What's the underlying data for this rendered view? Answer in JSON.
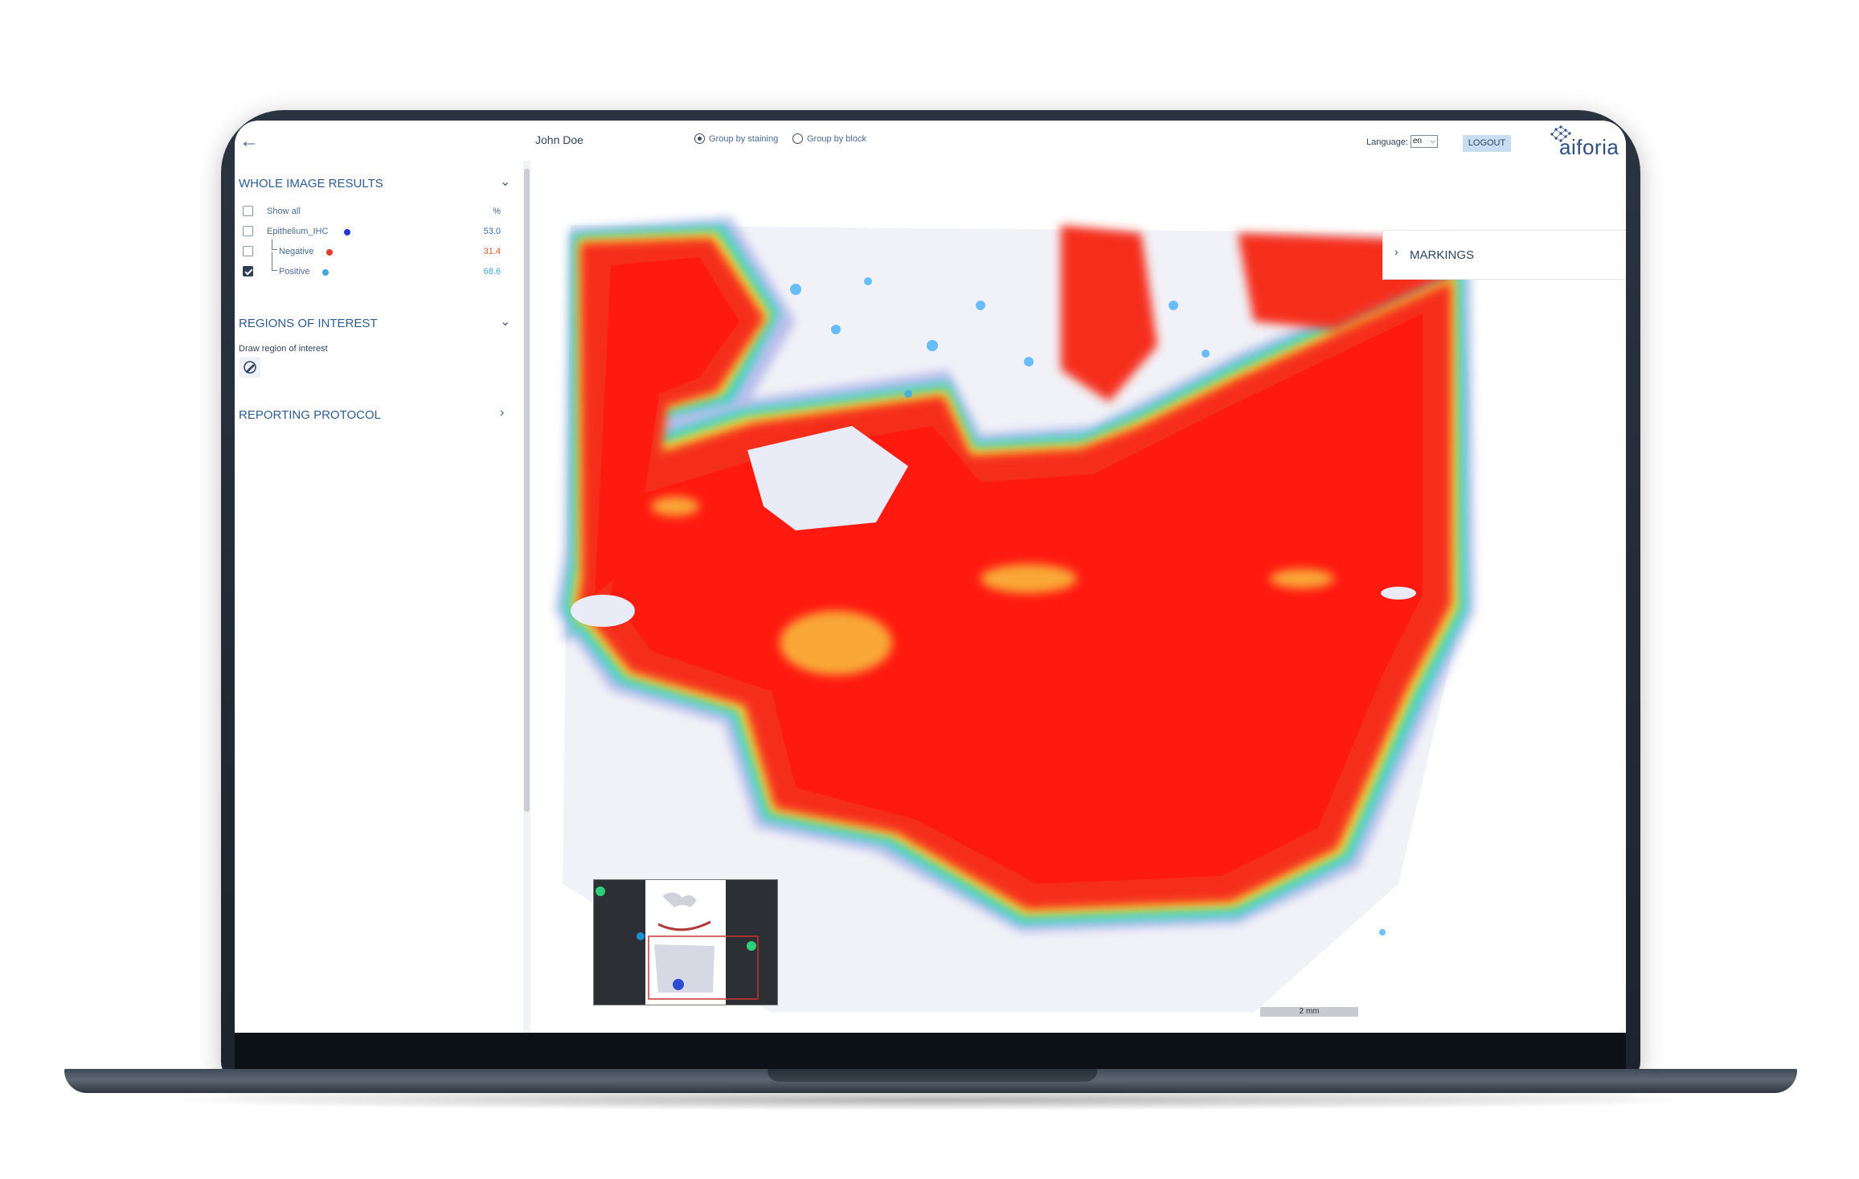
{
  "topbar": {
    "user_name": "John Doe",
    "group_by_staining": "Group by staining",
    "group_by_block": "Group by block",
    "language_label": "Language:",
    "language_value": "en",
    "logout_label": "LOGOUT",
    "brand": "aiforia"
  },
  "panel": {
    "whole_image_results": {
      "title": "WHOLE IMAGE RESULTS",
      "header_label": "Show all",
      "header_unit": "%",
      "rows": [
        {
          "label": "Epithelium_IHC",
          "value": "53.0",
          "color": "#1f35d6",
          "value_color": "#2e6fb5",
          "checked": false
        },
        {
          "label": "Negative",
          "value": "31.4",
          "color": "#e43b2c",
          "value_color": "#e4582c",
          "checked": false
        },
        {
          "label": "Positive",
          "value": "68.6",
          "color": "#44a7e0",
          "value_color": "#44a7e0",
          "checked": true
        }
      ]
    },
    "regions_of_interest": {
      "title": "REGIONS OF INTEREST",
      "draw_label": "Draw region of interest"
    },
    "reporting_protocol": {
      "title": "REPORTING PROTOCOL"
    }
  },
  "viewer": {
    "markings_label": "MARKINGS",
    "scale_label": "2 mm"
  },
  "icons": {
    "back": "arrow-left-icon",
    "draw": "pencil-icon",
    "expand": "chevron-down-icon",
    "collapse": "chevron-right-icon"
  }
}
